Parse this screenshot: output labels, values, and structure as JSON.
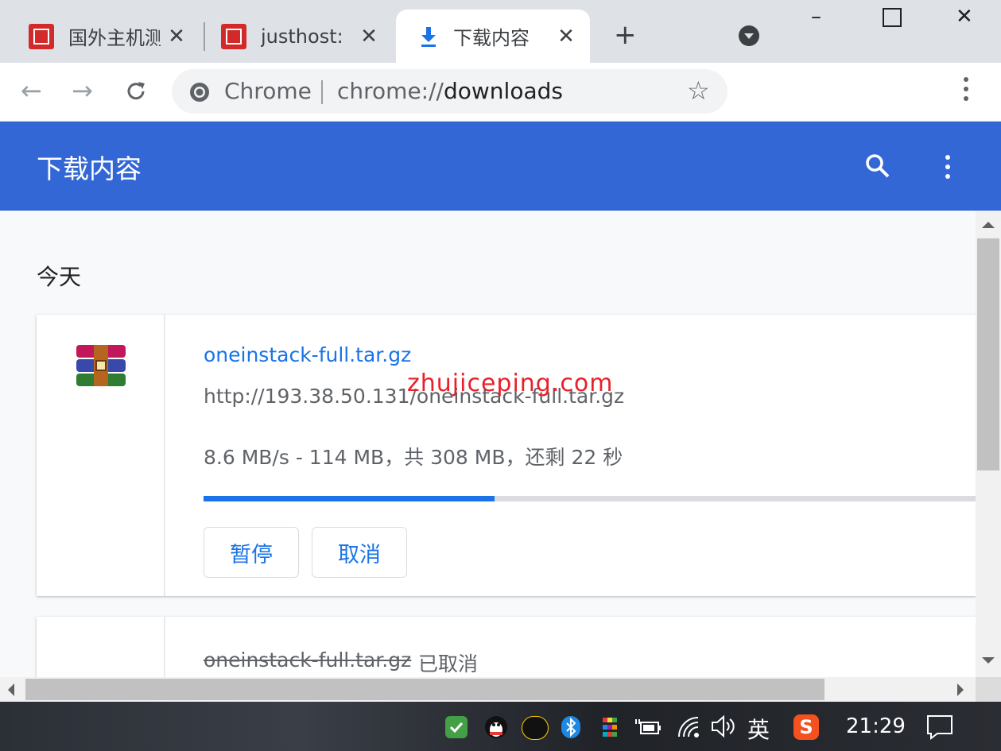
{
  "window": {
    "minimize_label": "–",
    "maximize_label": "☐",
    "close_label": "✕"
  },
  "tabs": [
    {
      "title": "国外主机测",
      "icon": "site-favicon",
      "active": false
    },
    {
      "title": "justhost:",
      "icon": "site-favicon",
      "active": false
    },
    {
      "title": "下载内容",
      "icon": "download-icon",
      "active": true
    }
  ],
  "toolbar": {
    "origin_label": "Chrome",
    "url_prefix": "chrome://",
    "url_path": "downloads"
  },
  "page": {
    "header_title": "下载内容",
    "section_today": "今天",
    "watermark": "zhujiceping.com"
  },
  "downloads": [
    {
      "filename": "oneinstack-full.tar.gz",
      "url": "http://193.38.50.131/oneinstack-full.tar.gz",
      "status": "8.6 MB/s - 114 MB，共 308 MB，还剩 22 秒",
      "progress": 0.37,
      "pause_label": "暂停",
      "cancel_label": "取消"
    },
    {
      "filename": "oneinstack-full.tar.gz",
      "status": "已取消"
    }
  ],
  "taskbar": {
    "ime_label": "英",
    "clock": "21:29"
  },
  "colors": {
    "header_blue": "#3367d6",
    "link_blue": "#1a73e8",
    "progress_blue": "#1a73e8",
    "progress_track": "#dadce0"
  }
}
